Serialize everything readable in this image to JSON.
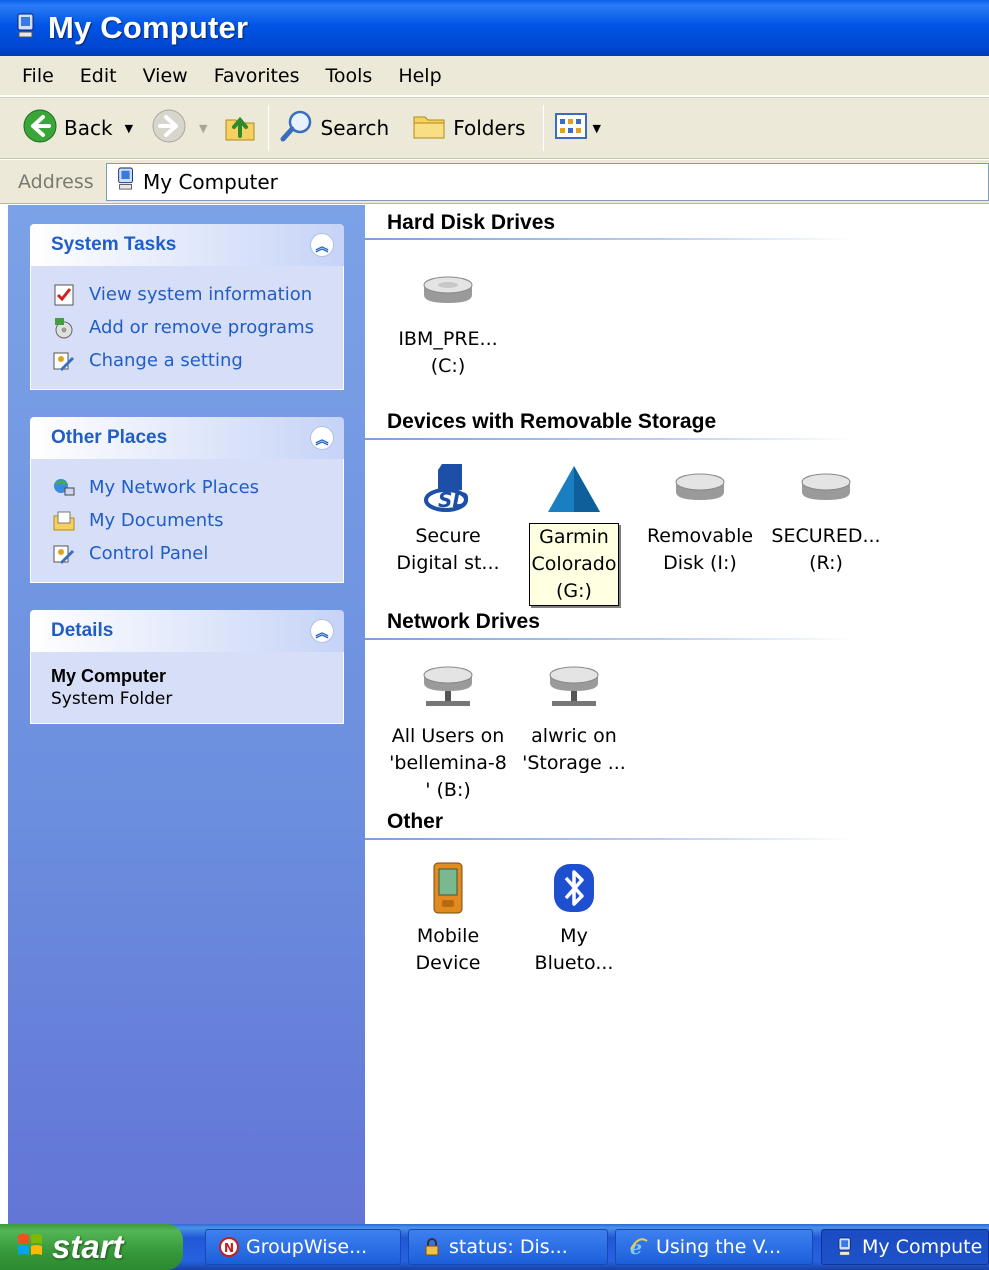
{
  "window": {
    "title": "My Computer"
  },
  "menu": [
    "File",
    "Edit",
    "View",
    "Favorites",
    "Tools",
    "Help"
  ],
  "toolbar": {
    "back": "Back",
    "search": "Search",
    "folders": "Folders"
  },
  "address": {
    "label": "Address",
    "value": "My Computer"
  },
  "system_tasks": {
    "title": "System Tasks",
    "items": [
      "View system information",
      "Add or remove programs",
      "Change a setting"
    ]
  },
  "other_places": {
    "title": "Other Places",
    "items": [
      "My Network Places",
      "My Documents",
      "Control Panel"
    ]
  },
  "details": {
    "title": "Details",
    "name": "My Computer",
    "desc": "System Folder"
  },
  "groups": {
    "hard_disk": {
      "title": "Hard Disk Drives",
      "items": [
        {
          "line1": "IBM_PRE...",
          "line2": "(C:)"
        }
      ]
    },
    "removable": {
      "title": "Devices with Removable Storage",
      "items": [
        {
          "line1": "Secure",
          "line2": "Digital st..."
        },
        {
          "line1": "Garmin",
          "line2": "Colorado",
          "line3": "(G:)"
        },
        {
          "line1": "Removable",
          "line2": "Disk (I:)"
        },
        {
          "line1": "SECURED...",
          "line2": "(R:)"
        }
      ]
    },
    "network": {
      "title": "Network Drives",
      "items": [
        {
          "line1": "All Users on",
          "line2": "'bellemina-8",
          "line3": "' (B:)"
        },
        {
          "line1": "alwric on",
          "line2": "'Storage ..."
        }
      ]
    },
    "other": {
      "title": "Other",
      "items": [
        {
          "line1": "Mobile",
          "line2": "Device"
        },
        {
          "line1": "My",
          "line2": "Blueto..."
        }
      ]
    }
  },
  "taskbar": {
    "start": "start",
    "buttons": [
      "GroupWise...",
      "status: Dis...",
      "Using the V...",
      "My Compute"
    ]
  }
}
